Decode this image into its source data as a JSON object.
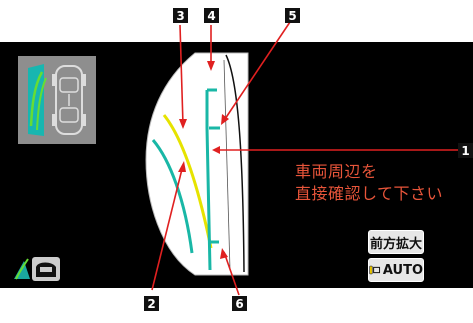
{
  "warning": {
    "line1": "車両周辺を",
    "line2": "直接確認して下さい"
  },
  "buttons": {
    "zoom_label": "前方拡大",
    "auto_label": "AUTO",
    "auto_icon": "camera-switch-icon",
    "mode_icon": "camera-view-mode-icon"
  },
  "callouts": {
    "c1": "1",
    "c2": "2",
    "c3": "3",
    "c4": "4",
    "c5": "5",
    "c6": "6"
  },
  "colors": {
    "warning_text": "#e8553a",
    "guide_cyan": "#19b7a6",
    "guide_yellow": "#e6e300",
    "button_bg": "#e7e7e7"
  }
}
